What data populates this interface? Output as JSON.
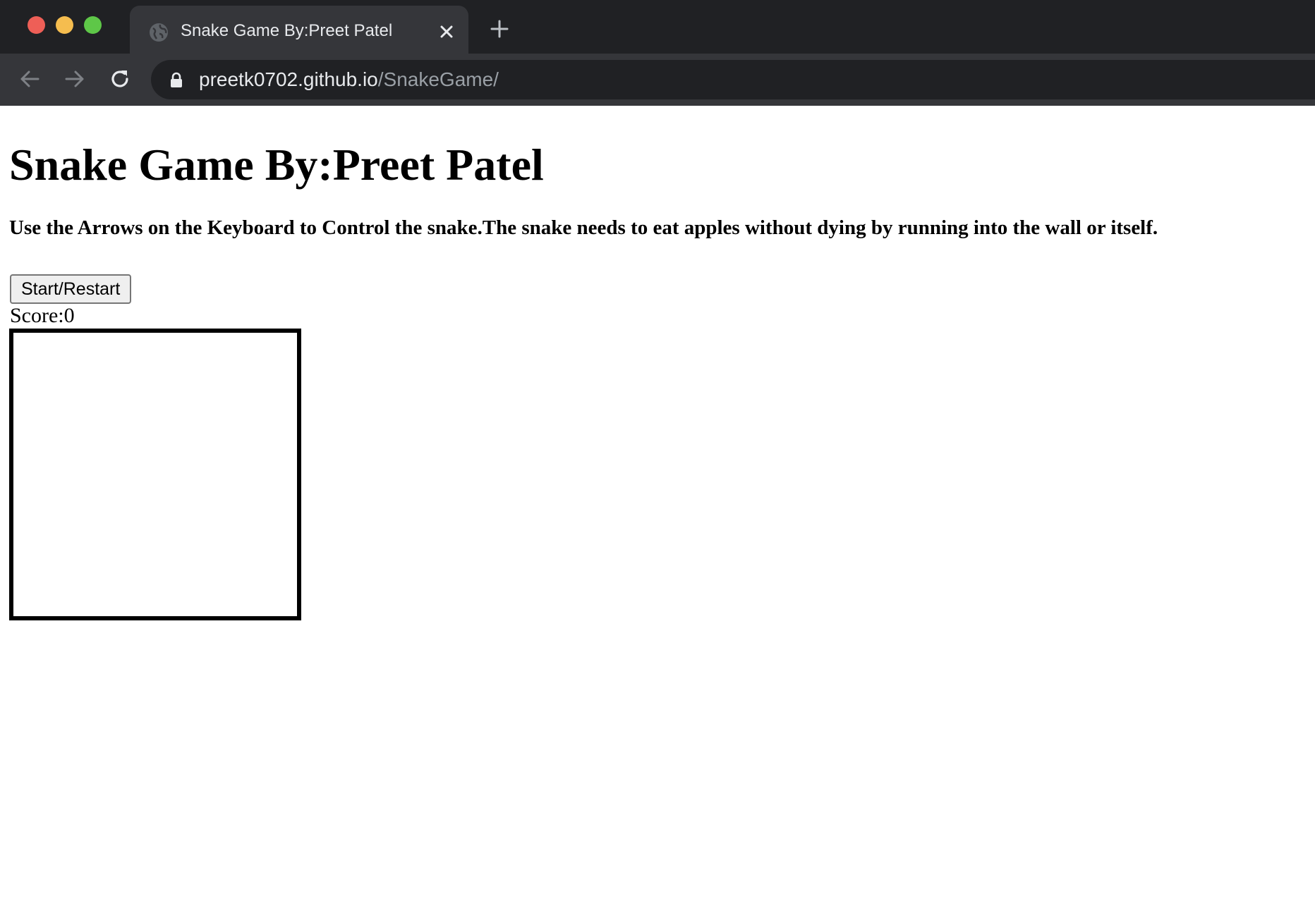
{
  "browser": {
    "tab": {
      "title": "Snake Game By:Preet Patel"
    },
    "address_bar": {
      "host": "preetk0702.github.io",
      "path": "/SnakeGame/"
    }
  },
  "page": {
    "title": "Snake Game By:Preet Patel",
    "instructions": "Use the Arrows on the Keyboard to Control the snake.The snake needs to eat apples without dying by running into the wall or itself.",
    "start_button_label": "Start/Restart",
    "score_label": "Score:",
    "score_value": "0"
  },
  "icons": {
    "tab_favicon": "globe-icon",
    "tab_close": "close-icon",
    "new_tab": "plus-icon",
    "back": "arrow-left-icon",
    "forward": "arrow-right-icon",
    "reload": "reload-icon",
    "secure": "lock-icon"
  },
  "colors": {
    "chrome_dark": "#202124",
    "chrome_tab": "#35363a",
    "traffic_red": "#ee5f57",
    "traffic_yellow": "#f5bd4f",
    "traffic_green": "#5ec748"
  }
}
